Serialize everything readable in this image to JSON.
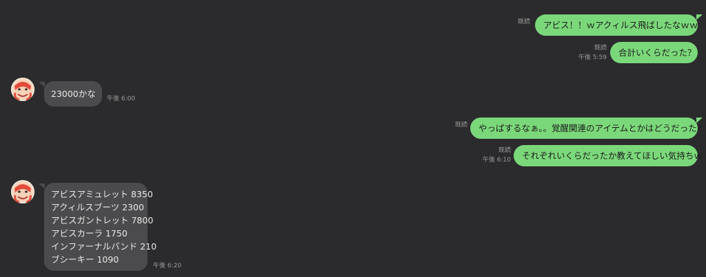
{
  "colors": {
    "background": "#2b2b2d",
    "outgoing_bubble": "#7bd87a",
    "incoming_bubble": "#4b4b4d",
    "meta_text": "#9c9c9c"
  },
  "messages": [
    {
      "direction": "out",
      "text": "アビス！！ｗアクィルス飛ばしたなｗｗ",
      "read": "既読",
      "time": ""
    },
    {
      "direction": "out",
      "text": "合計いくらだった？",
      "read": "既読",
      "time": "午後 5:59"
    },
    {
      "direction": "in",
      "text": "23000かな",
      "time": "午後 6:00",
      "avatar_icon": "user-avatar-icon"
    },
    {
      "direction": "out",
      "text": "やっぱするなぁ。。覚醒関連のアイテムとかはどうだった？",
      "read": "既読",
      "time": ""
    },
    {
      "direction": "out",
      "text": "それぞれいくらだったか教えてほしい気持ちｗ",
      "read": "既読",
      "time": "午後 6:10"
    },
    {
      "direction": "in",
      "lines": [
        "アビスアミュレット 8350",
        "アクィルスブーツ 2300",
        "アビスガントレット 7800",
        "アビスカーラ 1750",
        "インファーナルバンド 210",
        "ブシーキー 1090"
      ],
      "time": "午後 6:20",
      "avatar_icon": "user-avatar-icon"
    }
  ]
}
